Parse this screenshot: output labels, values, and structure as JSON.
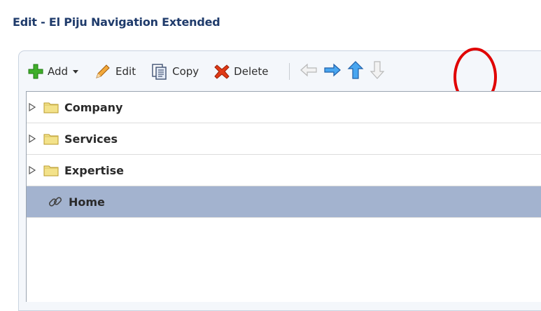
{
  "window": {
    "title": "Edit - El Piju Navigation Extended"
  },
  "toolbar": {
    "add_label": "Add",
    "edit_label": "Edit",
    "copy_label": "Copy",
    "delete_label": "Delete"
  },
  "tree": {
    "items": [
      {
        "label": "Company",
        "type": "folder"
      },
      {
        "label": "Services",
        "type": "folder"
      },
      {
        "label": "Expertise",
        "type": "folder"
      },
      {
        "label": "Home",
        "type": "link",
        "selected": true
      }
    ]
  },
  "colors": {
    "title": "#1f3b6b",
    "selected_row": "#a3b3cf",
    "highlight": "#e00000"
  }
}
